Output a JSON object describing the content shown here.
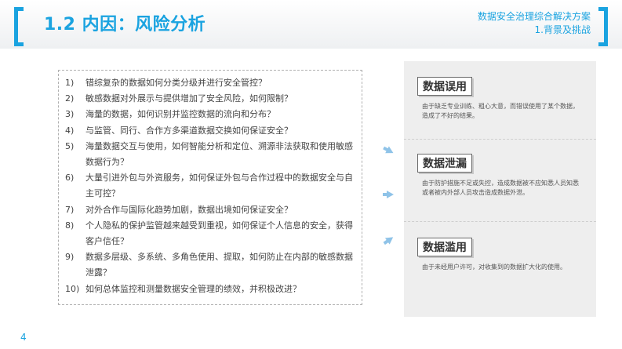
{
  "header": {
    "title": "1.2 内因：风险分析",
    "subtitle_line1": "数据安全治理综合解决方案",
    "subtitle_line2": "1.背景及挑战"
  },
  "questions": [
    {
      "num": "1)",
      "text": "错综复杂的数据如何分类分级并进行安全管控？"
    },
    {
      "num": "2)",
      "text": "敏感数据对外展示与提供增加了安全风险，如何限制？"
    },
    {
      "num": "3)",
      "text": "海量的数据，如何识别并监控数据的流向和分布？"
    },
    {
      "num": "4)",
      "text": "与监管、同行、合作方多渠道数据交换如何保证安全？"
    },
    {
      "num": "5)",
      "text": "海量数据交互与使用，如何智能分析和定位、溯源非法获取和使用敏感数据行为？"
    },
    {
      "num": "6)",
      "text": "大量引进外包与外资服务，如何保证外包与合作过程中的数据安全与自主可控？"
    },
    {
      "num": "7)",
      "text": "对外合作与国际化趋势加剧，数据出境如何保证安全？"
    },
    {
      "num": "8)",
      "text": "个人隐私的保护监管越来越受到重视，如何保证个人信息的安全，获得客户信任？"
    },
    {
      "num": "9)",
      "text": "数据多层级、多系统、多角色使用、提取，如何防止在内部的敏感数据泄露？"
    },
    {
      "num": "10)",
      "text": "如何总体监控和测量数据安全管理的绩效，并积极改进？"
    }
  ],
  "risks": [
    {
      "title": "数据误用",
      "desc": "由于缺乏专业训练、粗心大意，而错误使用了某个数据，造成了不好的结果。"
    },
    {
      "title": "数据泄漏",
      "desc": "由于防护措施不足或失控，造成数据被不应知悉人员知悉或者被内外部人员攻击造成数据外泄。"
    },
    {
      "title": "数据滥用",
      "desc": "由于未经用户许可，对收集到的数据扩大化的使用。"
    }
  ],
  "footer": {
    "page_number": "4"
  },
  "colors": {
    "accent": "#1aa3e0",
    "panel": "#eeeeee"
  }
}
